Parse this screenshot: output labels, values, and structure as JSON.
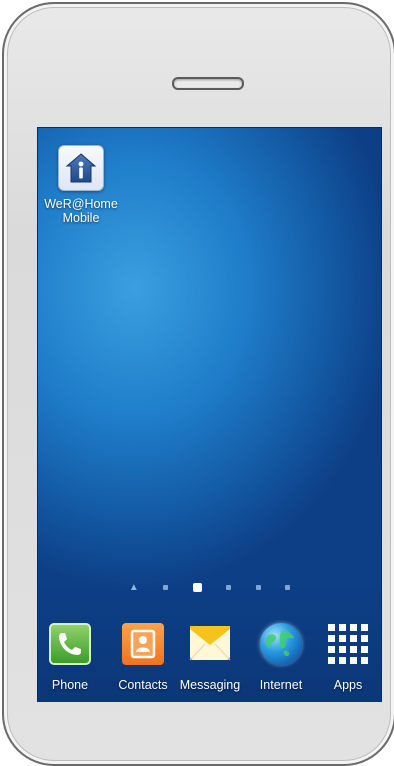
{
  "home_screen": {
    "app_label": "WeR@Home\nMobile",
    "app_label_line1": "WeR@Home",
    "app_label_line2": "Mobile"
  },
  "pager": {
    "page_count": 6,
    "active_index": 2
  },
  "dock": {
    "items": [
      {
        "label": "Phone",
        "icon": "phone-icon"
      },
      {
        "label": "Contacts",
        "icon": "contacts-icon"
      },
      {
        "label": "Messaging",
        "icon": "messaging-icon"
      },
      {
        "label": "Internet",
        "icon": "internet-globe-icon"
      },
      {
        "label": "Apps",
        "icon": "apps-grid-icon"
      }
    ]
  },
  "colors": {
    "wallpaper_light": "#3a9fe0",
    "wallpaper_dark": "#0d3f86",
    "phone_body": "#e2e2e2",
    "phone_outline": "#6b6b6b"
  }
}
